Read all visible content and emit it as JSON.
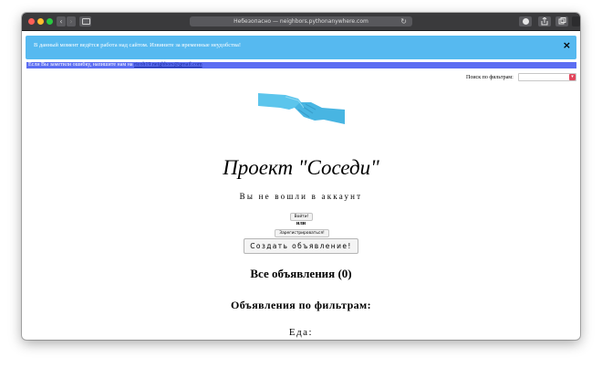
{
  "browser": {
    "url": "Небезопасно — neighbors.pythonanywhere.com",
    "nav_back": "‹",
    "nav_forward": "›",
    "reload": "↻"
  },
  "alert": {
    "text": "В данный момент ведётся работа над сайтом. Извините за временные неудобства!",
    "close": "×"
  },
  "report": {
    "text": "Если Вы заметили ошибку, напишите нам на ",
    "email": "ricoh19.neighbors@gmail.com"
  },
  "filter": {
    "label": "Поиск по фильтрам:",
    "selected": ""
  },
  "hero": {
    "image": "handshake-gloves-image",
    "title": "Проект \"Соседи\"",
    "status": "Вы не вошли в аккаунт"
  },
  "auth": {
    "login_label": "Войти!",
    "or_label": "или",
    "register_label": "Зарегистрироваться!"
  },
  "actions": {
    "create_label": "Создать объявление!"
  },
  "sections": {
    "all_ads": "Все объявления (0)",
    "filtered_ads": "Объявления по фильтрам:",
    "category": "Еда:"
  },
  "colors": {
    "alert_bg": "#56b9f0",
    "report_bg": "#5c6ef2",
    "select_arrow": "#e2455b",
    "glove": "#5cc5ec"
  }
}
